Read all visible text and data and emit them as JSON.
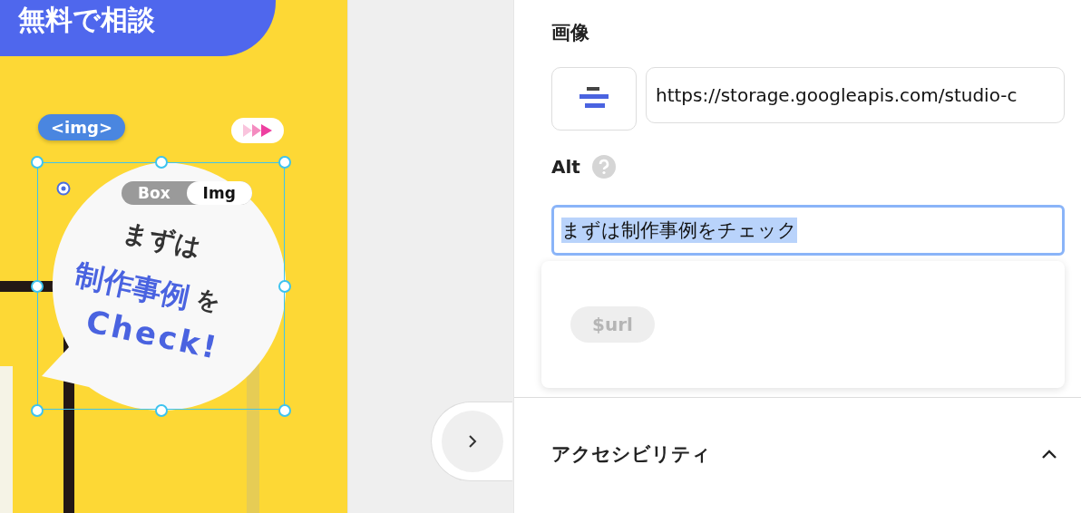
{
  "canvas": {
    "banner_text": "無料で相談",
    "tag": "<img>",
    "mode_toggle": [
      {
        "label": "Box",
        "selected": false
      },
      {
        "label": "Img",
        "selected": true
      }
    ],
    "bubble_texts": [
      {
        "text": "まずは",
        "kind": "plain"
      },
      {
        "text": "制作事例",
        "kind": "accent"
      },
      {
        "text": "を",
        "kind": "plain"
      },
      {
        "text": "Check!",
        "kind": "accent"
      }
    ]
  },
  "panel": {
    "image_section": {
      "title": "画像",
      "url": "https://storage.googleapis.com/studio-c"
    },
    "alt": {
      "label": "Alt",
      "value": "まずは制作事例をチェック"
    },
    "suggestions": [
      "$url"
    ],
    "accessibility": {
      "title": "アクセシビリティ",
      "expanded": true
    }
  }
}
